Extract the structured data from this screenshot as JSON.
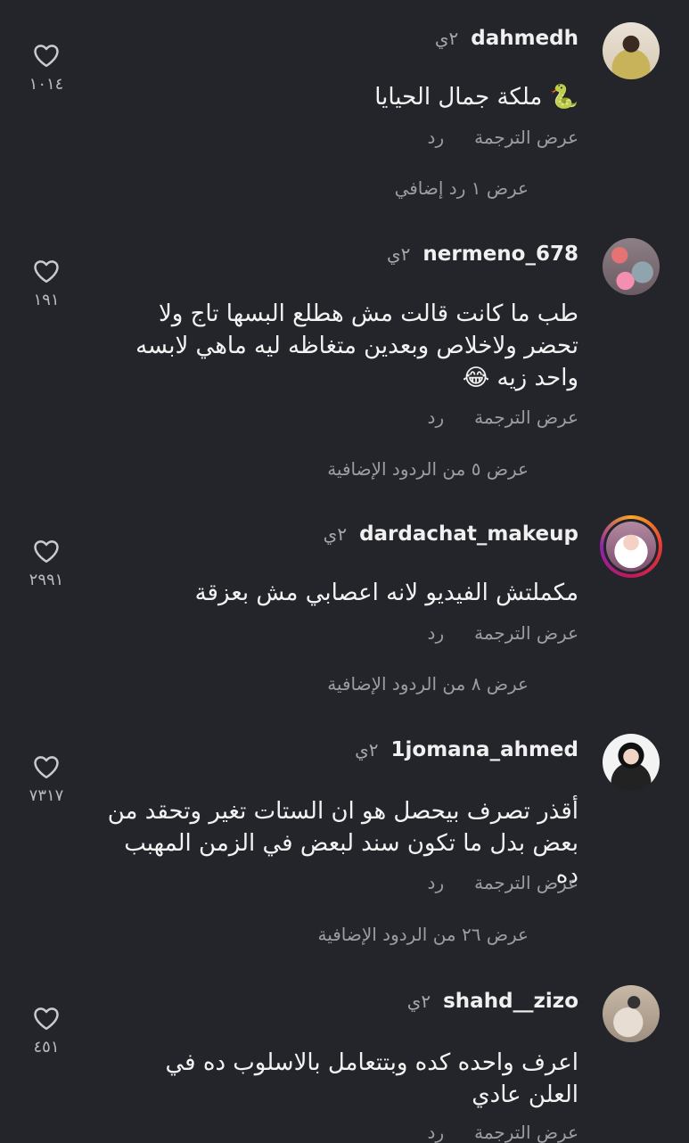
{
  "comments": [
    {
      "username": "dahmedh",
      "time": "٢ي",
      "text": "🐍 ملكة جمال الحيايا",
      "reply": "رد",
      "translate": "عرض الترجمة",
      "more_replies": "عرض ١ رد إضافي",
      "likes": "١٠١٤",
      "avatar_icon": "profile-photo"
    },
    {
      "username": "nermeno_678",
      "time": "٢ي",
      "text": "طب ما كانت قالت مش هطلع البسها تاج ولا تحضر ولاخلاص وبعدين متغاظه ليه ماهي لابسه واحد زيه 😂",
      "reply": "رد",
      "translate": "عرض الترجمة",
      "more_replies": "عرض ٥ من الردود الإضافية",
      "likes": "١٩١",
      "avatar_icon": "profile-photo"
    },
    {
      "username": "dardachat_makeup",
      "time": "٢ي",
      "text": "مكملتش الفيديو لانه اعصابي مش بعزقة",
      "reply": "رد",
      "translate": "عرض الترجمة",
      "more_replies": "عرض ٨ من الردود الإضافية",
      "likes": "٢٩٩١",
      "avatar_icon": "profile-photo-story-ring"
    },
    {
      "username": "1jomana_ahmed",
      "time": "٢ي",
      "text": "أقذر تصرف بيحصل هو ان الستات تغير وتحقد من بعض بدل ما تكون سند لبعض في الزمن المهبب ده",
      "reply": "رد",
      "translate": "عرض الترجمة",
      "more_replies": "عرض ٢٦ من الردود الإضافية",
      "likes": "٧٣١٧",
      "avatar_icon": "profile-photo"
    },
    {
      "username": "shahd__zizo",
      "time": "٢ي",
      "text": "اعرف واحده كده وبتتعامل بالاسلوب ده في العلن عادي",
      "reply": "رد",
      "translate": "عرض الترجمة",
      "more_replies": "",
      "likes": "٤٥١",
      "avatar_icon": "profile-photo"
    }
  ],
  "icons": {
    "like": "heart-outline-icon"
  },
  "colors": {
    "background": "#24252a",
    "secondary_text": "#9c9da1"
  }
}
